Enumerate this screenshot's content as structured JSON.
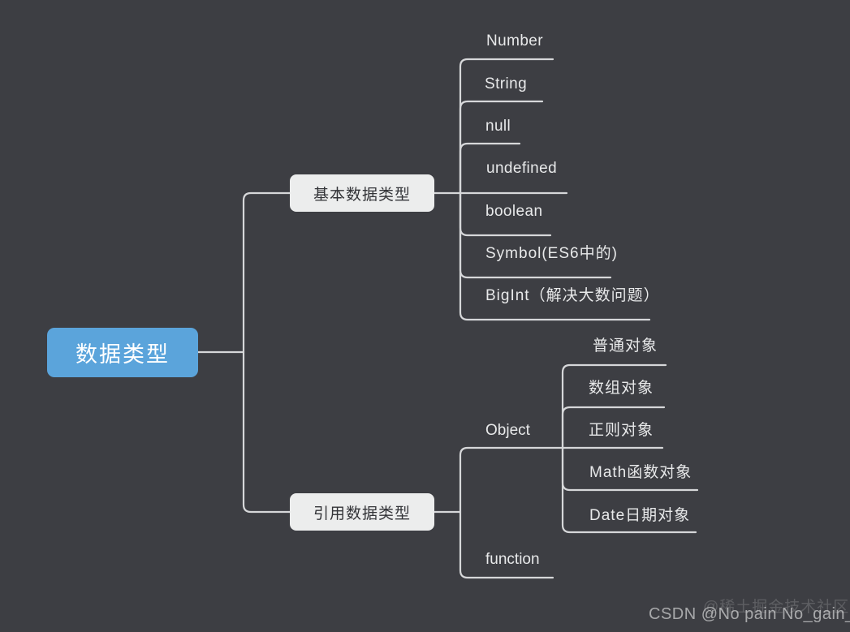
{
  "diagram": {
    "title": "数据类型",
    "type": "mindmap",
    "background_color": "#3d3e43",
    "root_color": "#5ba4db",
    "node_color": "#eceded",
    "line_color": "#d6d7d9",
    "text_color": "#e8e9ea"
  },
  "root": {
    "label": "数据类型"
  },
  "categories": {
    "primitive": {
      "label": "基本数据类型"
    },
    "reference": {
      "label": "引用数据类型"
    }
  },
  "primitive_types": [
    {
      "label": "Number"
    },
    {
      "label": "String"
    },
    {
      "label": "null"
    },
    {
      "label": "undefined"
    },
    {
      "label": "boolean"
    },
    {
      "label": "Symbol(ES6中的)"
    },
    {
      "label": "BigInt（解决大数问题）"
    }
  ],
  "reference_branches": [
    {
      "label": "Object"
    },
    {
      "label": "function"
    }
  ],
  "object_types": [
    {
      "label": "普通对象"
    },
    {
      "label": "数组对象"
    },
    {
      "label": "正则对象"
    },
    {
      "label": "Math函数对象"
    },
    {
      "label": "Date日期对象"
    }
  ],
  "watermarks": {
    "juejin": "@稀土掘金技术社区",
    "csdn": "CSDN @No pain No_gain_"
  }
}
